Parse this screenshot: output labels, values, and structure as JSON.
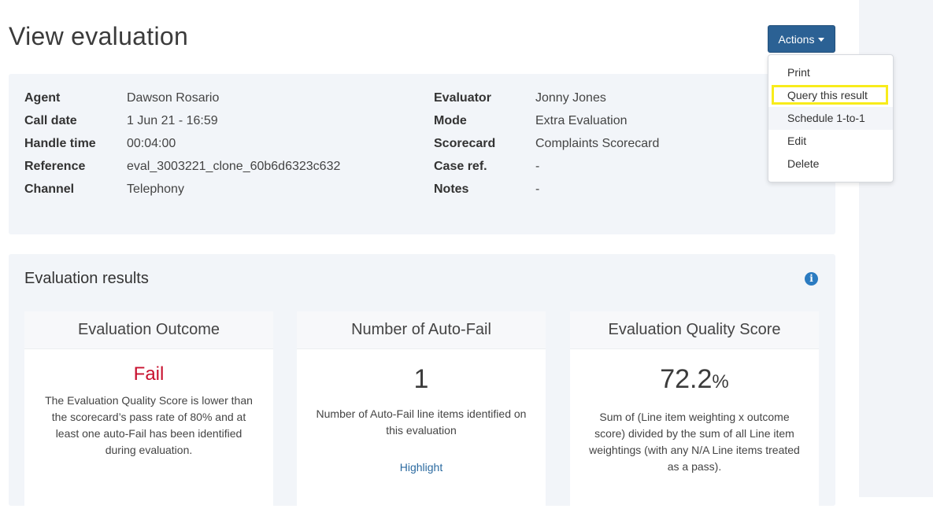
{
  "page": {
    "title": "View evaluation"
  },
  "actions": {
    "button_label": "Actions",
    "menu": [
      "Print",
      "Query this result",
      "Schedule 1-to-1",
      "Edit",
      "Delete"
    ]
  },
  "info": {
    "left": [
      {
        "label": "Agent",
        "value": "Dawson Rosario"
      },
      {
        "label": "Call date",
        "value": "1 Jun 21 - 16:59"
      },
      {
        "label": "Handle time",
        "value": "00:04:00"
      },
      {
        "label": "Reference",
        "value": "eval_3003221_clone_60b6d6323c632"
      },
      {
        "label": "Channel",
        "value": "Telephony"
      }
    ],
    "right": [
      {
        "label": "Evaluator",
        "value": "Jonny Jones"
      },
      {
        "label": "Mode",
        "value": "Extra Evaluation"
      },
      {
        "label": "Scorecard",
        "value": "Complaints Scorecard"
      },
      {
        "label": "Case ref.",
        "value": "-"
      },
      {
        "label": "Notes",
        "value": "-"
      }
    ]
  },
  "results": {
    "title": "Evaluation results",
    "cards": [
      {
        "header": "Evaluation Outcome",
        "value": "Fail",
        "description": "The Evaluation Quality Score is lower than the scorecard’s pass rate of 80% and at least one auto-Fail has been identified during evaluation."
      },
      {
        "header": "Number of Auto-Fail",
        "value": "1",
        "description": "Number of Auto-Fail line items identified on this evaluation",
        "link": "Highlight"
      },
      {
        "header": "Evaluation Quality Score",
        "value": "72.2",
        "unit": "%",
        "description": "Sum of (Line item weighting x outcome score) divided by the sum of all Line item weightings (with any N/A Line items treated as a pass)."
      }
    ]
  },
  "colors": {
    "primary": "#2b6194",
    "fail": "#c8102e",
    "highlight": "#f8ec1b",
    "panel": "#f2f5f9"
  }
}
